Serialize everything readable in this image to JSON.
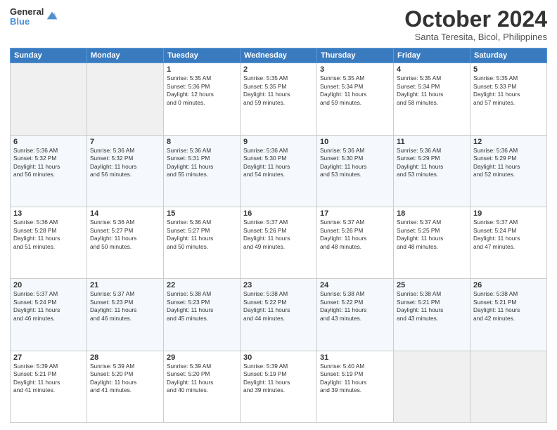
{
  "header": {
    "logo_line1": "General",
    "logo_line2": "Blue",
    "month": "October 2024",
    "location": "Santa Teresita, Bicol, Philippines"
  },
  "columns": [
    "Sunday",
    "Monday",
    "Tuesday",
    "Wednesday",
    "Thursday",
    "Friday",
    "Saturday"
  ],
  "rows": [
    [
      {
        "day": "",
        "content": ""
      },
      {
        "day": "",
        "content": ""
      },
      {
        "day": "1",
        "content": "Sunrise: 5:35 AM\nSunset: 5:36 PM\nDaylight: 12 hours\nand 0 minutes."
      },
      {
        "day": "2",
        "content": "Sunrise: 5:35 AM\nSunset: 5:35 PM\nDaylight: 11 hours\nand 59 minutes."
      },
      {
        "day": "3",
        "content": "Sunrise: 5:35 AM\nSunset: 5:34 PM\nDaylight: 11 hours\nand 59 minutes."
      },
      {
        "day": "4",
        "content": "Sunrise: 5:35 AM\nSunset: 5:34 PM\nDaylight: 11 hours\nand 58 minutes."
      },
      {
        "day": "5",
        "content": "Sunrise: 5:35 AM\nSunset: 5:33 PM\nDaylight: 11 hours\nand 57 minutes."
      }
    ],
    [
      {
        "day": "6",
        "content": "Sunrise: 5:36 AM\nSunset: 5:32 PM\nDaylight: 11 hours\nand 56 minutes."
      },
      {
        "day": "7",
        "content": "Sunrise: 5:36 AM\nSunset: 5:32 PM\nDaylight: 11 hours\nand 56 minutes."
      },
      {
        "day": "8",
        "content": "Sunrise: 5:36 AM\nSunset: 5:31 PM\nDaylight: 11 hours\nand 55 minutes."
      },
      {
        "day": "9",
        "content": "Sunrise: 5:36 AM\nSunset: 5:30 PM\nDaylight: 11 hours\nand 54 minutes."
      },
      {
        "day": "10",
        "content": "Sunrise: 5:36 AM\nSunset: 5:30 PM\nDaylight: 11 hours\nand 53 minutes."
      },
      {
        "day": "11",
        "content": "Sunrise: 5:36 AM\nSunset: 5:29 PM\nDaylight: 11 hours\nand 53 minutes."
      },
      {
        "day": "12",
        "content": "Sunrise: 5:36 AM\nSunset: 5:29 PM\nDaylight: 11 hours\nand 52 minutes."
      }
    ],
    [
      {
        "day": "13",
        "content": "Sunrise: 5:36 AM\nSunset: 5:28 PM\nDaylight: 11 hours\nand 51 minutes."
      },
      {
        "day": "14",
        "content": "Sunrise: 5:36 AM\nSunset: 5:27 PM\nDaylight: 11 hours\nand 50 minutes."
      },
      {
        "day": "15",
        "content": "Sunrise: 5:36 AM\nSunset: 5:27 PM\nDaylight: 11 hours\nand 50 minutes."
      },
      {
        "day": "16",
        "content": "Sunrise: 5:37 AM\nSunset: 5:26 PM\nDaylight: 11 hours\nand 49 minutes."
      },
      {
        "day": "17",
        "content": "Sunrise: 5:37 AM\nSunset: 5:26 PM\nDaylight: 11 hours\nand 48 minutes."
      },
      {
        "day": "18",
        "content": "Sunrise: 5:37 AM\nSunset: 5:25 PM\nDaylight: 11 hours\nand 48 minutes."
      },
      {
        "day": "19",
        "content": "Sunrise: 5:37 AM\nSunset: 5:24 PM\nDaylight: 11 hours\nand 47 minutes."
      }
    ],
    [
      {
        "day": "20",
        "content": "Sunrise: 5:37 AM\nSunset: 5:24 PM\nDaylight: 11 hours\nand 46 minutes."
      },
      {
        "day": "21",
        "content": "Sunrise: 5:37 AM\nSunset: 5:23 PM\nDaylight: 11 hours\nand 46 minutes."
      },
      {
        "day": "22",
        "content": "Sunrise: 5:38 AM\nSunset: 5:23 PM\nDaylight: 11 hours\nand 45 minutes."
      },
      {
        "day": "23",
        "content": "Sunrise: 5:38 AM\nSunset: 5:22 PM\nDaylight: 11 hours\nand 44 minutes."
      },
      {
        "day": "24",
        "content": "Sunrise: 5:38 AM\nSunset: 5:22 PM\nDaylight: 11 hours\nand 43 minutes."
      },
      {
        "day": "25",
        "content": "Sunrise: 5:38 AM\nSunset: 5:21 PM\nDaylight: 11 hours\nand 43 minutes."
      },
      {
        "day": "26",
        "content": "Sunrise: 5:38 AM\nSunset: 5:21 PM\nDaylight: 11 hours\nand 42 minutes."
      }
    ],
    [
      {
        "day": "27",
        "content": "Sunrise: 5:39 AM\nSunset: 5:21 PM\nDaylight: 11 hours\nand 41 minutes."
      },
      {
        "day": "28",
        "content": "Sunrise: 5:39 AM\nSunset: 5:20 PM\nDaylight: 11 hours\nand 41 minutes."
      },
      {
        "day": "29",
        "content": "Sunrise: 5:39 AM\nSunset: 5:20 PM\nDaylight: 11 hours\nand 40 minutes."
      },
      {
        "day": "30",
        "content": "Sunrise: 5:39 AM\nSunset: 5:19 PM\nDaylight: 11 hours\nand 39 minutes."
      },
      {
        "day": "31",
        "content": "Sunrise: 5:40 AM\nSunset: 5:19 PM\nDaylight: 11 hours\nand 39 minutes."
      },
      {
        "day": "",
        "content": ""
      },
      {
        "day": "",
        "content": ""
      }
    ]
  ]
}
